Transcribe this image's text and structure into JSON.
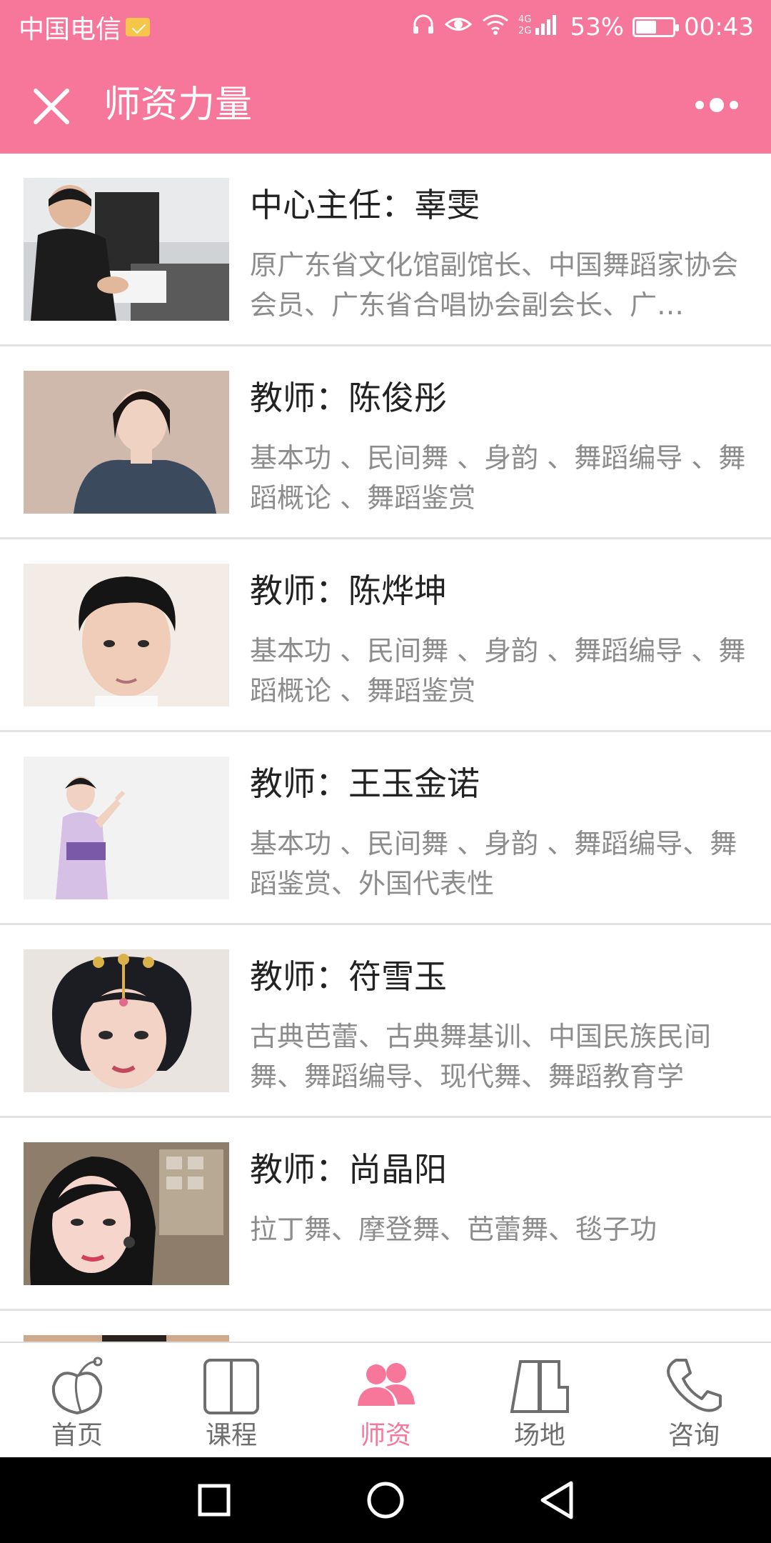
{
  "status_bar": {
    "carrier": "中国电信",
    "network": "4G 2G",
    "battery": "53%",
    "time": "00:43"
  },
  "header": {
    "title": "师资力量"
  },
  "teachers": [
    {
      "title": "中心主任：辜雯",
      "desc": "原广东省文化馆副馆长、中国舞蹈家协会会员、广东省合唱协会副会长、广…"
    },
    {
      "title": "教师：陈俊彤",
      "desc": "基本功 、民间舞 、身韵 、舞蹈编导 、舞蹈概论 、舞蹈鉴赏"
    },
    {
      "title": "教师：陈烨坤",
      "desc": "基本功 、民间舞 、身韵 、舞蹈编导 、舞蹈概论 、舞蹈鉴赏"
    },
    {
      "title": "教师：王玉金诺",
      "desc": "基本功 、民间舞 、身韵 、舞蹈编导、舞蹈鉴赏、外国代表性"
    },
    {
      "title": "教师：符雪玉",
      "desc": "古典芭蕾、古典舞基训、中国民族民间舞、舞蹈编导、现代舞、舞蹈教育学"
    },
    {
      "title": "教师：尚晶阳",
      "desc": "拉丁舞、摩登舞、芭蕾舞、毯子功"
    }
  ],
  "tabbar": {
    "items": [
      {
        "label": "首页",
        "icon": "peach-icon",
        "active": false
      },
      {
        "label": "课程",
        "icon": "book-icon",
        "active": false
      },
      {
        "label": "师资",
        "icon": "people-icon",
        "active": true
      },
      {
        "label": "场地",
        "icon": "building-icon",
        "active": false
      },
      {
        "label": "咨询",
        "icon": "phone-icon",
        "active": false
      }
    ]
  },
  "colors": {
    "accent": "#f7779b",
    "tab_inactive": "#6e6e6e",
    "desc_text": "#8c8c8c"
  }
}
